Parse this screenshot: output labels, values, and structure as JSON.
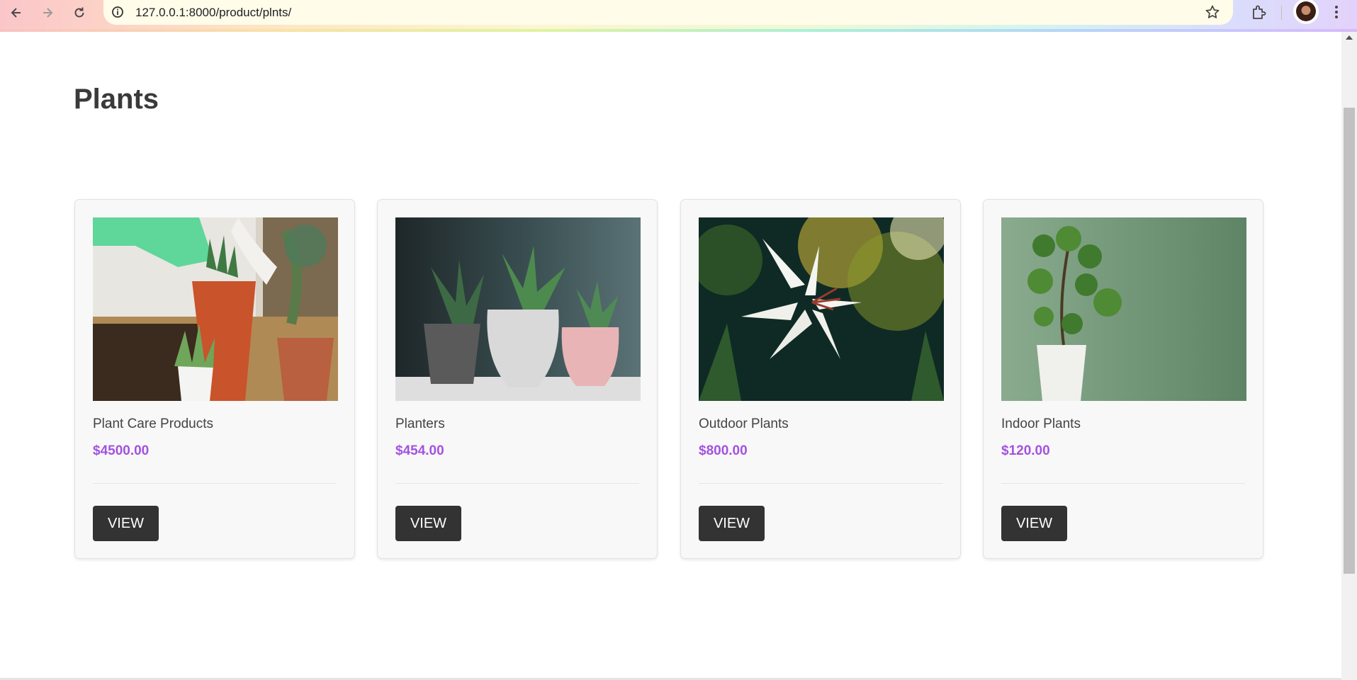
{
  "browser": {
    "url": "127.0.0.1:8000/product/plnts/",
    "icons": [
      "back-icon",
      "forward-icon",
      "reload-icon",
      "info-icon",
      "star-icon",
      "extensions-icon",
      "avatar",
      "menu-icon"
    ]
  },
  "page": {
    "title": "Plants"
  },
  "products": [
    {
      "name": "Plant Care Products",
      "price": "$4500.00",
      "button": "VIEW"
    },
    {
      "name": "Planters",
      "price": "$454.00",
      "button": "VIEW"
    },
    {
      "name": "Outdoor Plants",
      "price": "$800.00",
      "button": "VIEW"
    },
    {
      "name": "Indoor Plants",
      "price": "$120.00",
      "button": "VIEW"
    }
  ],
  "colors": {
    "price": "#a352e0",
    "button_bg": "#333333",
    "title": "#3a3a3a"
  }
}
